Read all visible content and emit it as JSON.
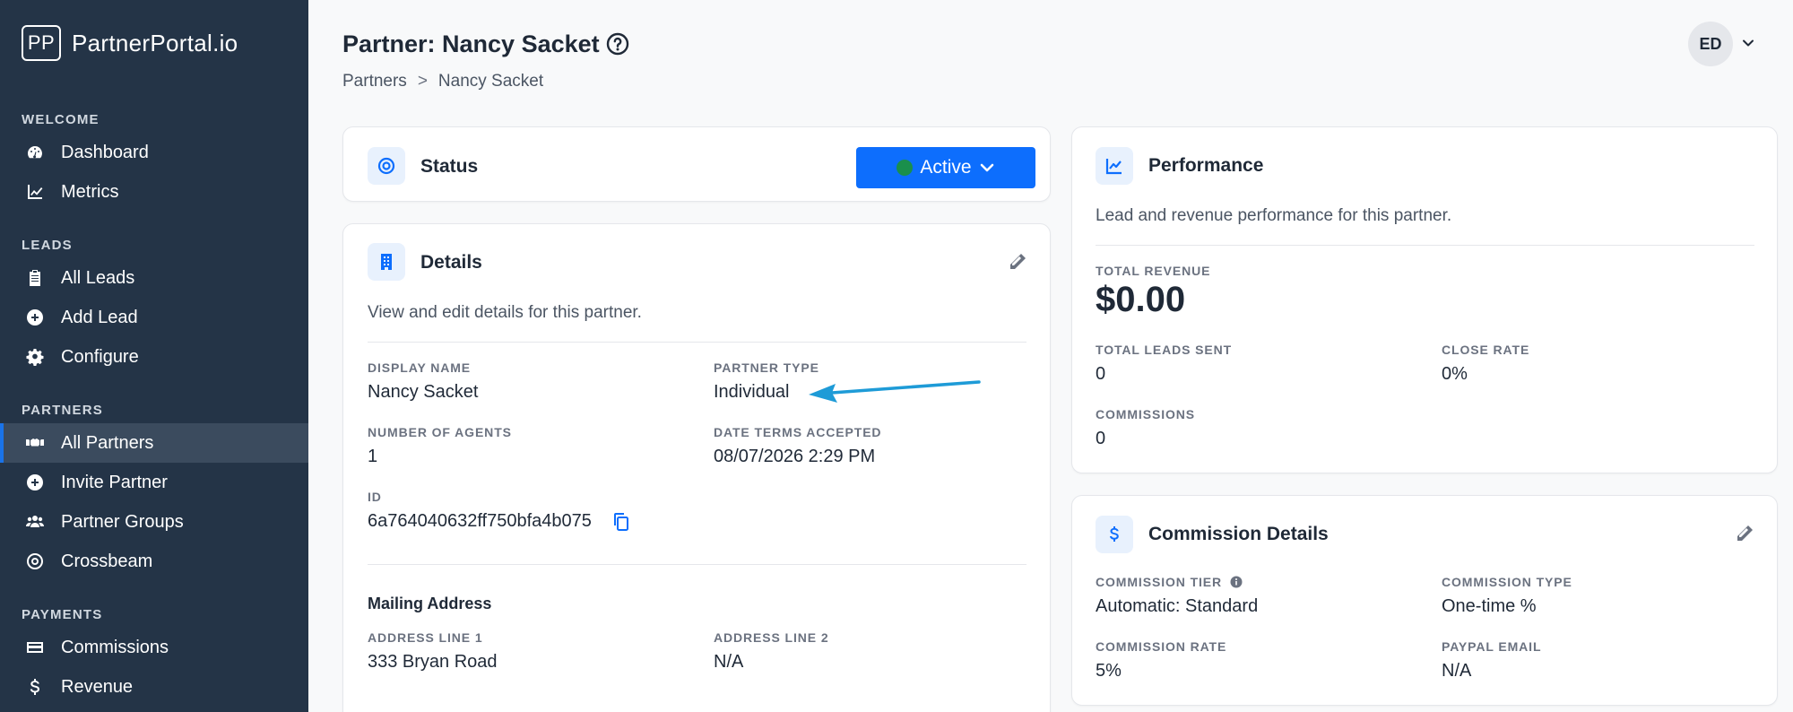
{
  "app": {
    "logo_mark": "PP",
    "name": "PartnerPortal.io"
  },
  "sidebar": {
    "sections": [
      {
        "title": "WELCOME",
        "items": [
          {
            "label": "Dashboard",
            "icon": "gauge-icon"
          },
          {
            "label": "Metrics",
            "icon": "chart-line-icon"
          }
        ]
      },
      {
        "title": "LEADS",
        "items": [
          {
            "label": "All Leads",
            "icon": "clipboard-icon"
          },
          {
            "label": "Add Lead",
            "icon": "plus-circle-icon"
          },
          {
            "label": "Configure",
            "icon": "gear-icon"
          }
        ]
      },
      {
        "title": "PARTNERS",
        "items": [
          {
            "label": "All Partners",
            "icon": "handshake-icon",
            "active": true
          },
          {
            "label": "Invite Partner",
            "icon": "plus-circle-icon"
          },
          {
            "label": "Partner Groups",
            "icon": "users-icon"
          },
          {
            "label": "Crossbeam",
            "icon": "target-icon"
          }
        ]
      },
      {
        "title": "PAYMENTS",
        "items": [
          {
            "label": "Commissions",
            "icon": "credit-card-icon"
          },
          {
            "label": "Revenue",
            "icon": "dollar-icon"
          }
        ]
      }
    ]
  },
  "header": {
    "title": "Partner: Nancy Sacket",
    "breadcrumb": [
      "Partners",
      "Nancy Sacket"
    ],
    "breadcrumb_sep": ">",
    "avatar_initials": "ED"
  },
  "status_card": {
    "title": "Status",
    "value": "Active",
    "accent": "#0d6efd",
    "dot_color": "#1a8f4c"
  },
  "details_card": {
    "title": "Details",
    "description": "View and edit details for this partner.",
    "fields": {
      "display_name": {
        "label": "DISPLAY NAME",
        "value": "Nancy Sacket"
      },
      "partner_type": {
        "label": "PARTNER TYPE",
        "value": "Individual"
      },
      "num_agents": {
        "label": "NUMBER OF AGENTS",
        "value": "1"
      },
      "date_terms": {
        "label": "DATE TERMS ACCEPTED",
        "value": "08/07/2026 2:29 PM"
      },
      "id": {
        "label": "ID",
        "value": "6a764040632ff750bfa4b075"
      }
    },
    "mailing": {
      "title": "Mailing Address",
      "line1": {
        "label": "ADDRESS LINE 1",
        "value": "333 Bryan Road"
      },
      "line2": {
        "label": "ADDRESS LINE 2",
        "value": "N/A"
      }
    }
  },
  "performance_card": {
    "title": "Performance",
    "description": "Lead and revenue performance for this partner.",
    "total_revenue": {
      "label": "TOTAL REVENUE",
      "value": "$0.00"
    },
    "total_leads": {
      "label": "TOTAL LEADS SENT",
      "value": "0"
    },
    "close_rate": {
      "label": "CLOSE RATE",
      "value": "0%"
    },
    "commissions": {
      "label": "COMMISSIONS",
      "value": "0"
    }
  },
  "commission_card": {
    "title": "Commission Details",
    "tier": {
      "label": "COMMISSION TIER",
      "value": "Automatic: Standard"
    },
    "type": {
      "label": "COMMISSION TYPE",
      "value": "One-time %"
    },
    "rate": {
      "label": "COMMISSION RATE",
      "value": "5%"
    },
    "paypal": {
      "label": "PAYPAL EMAIL",
      "value": "N/A"
    }
  },
  "annotation": {
    "arrow_color": "#1e9bd7"
  }
}
